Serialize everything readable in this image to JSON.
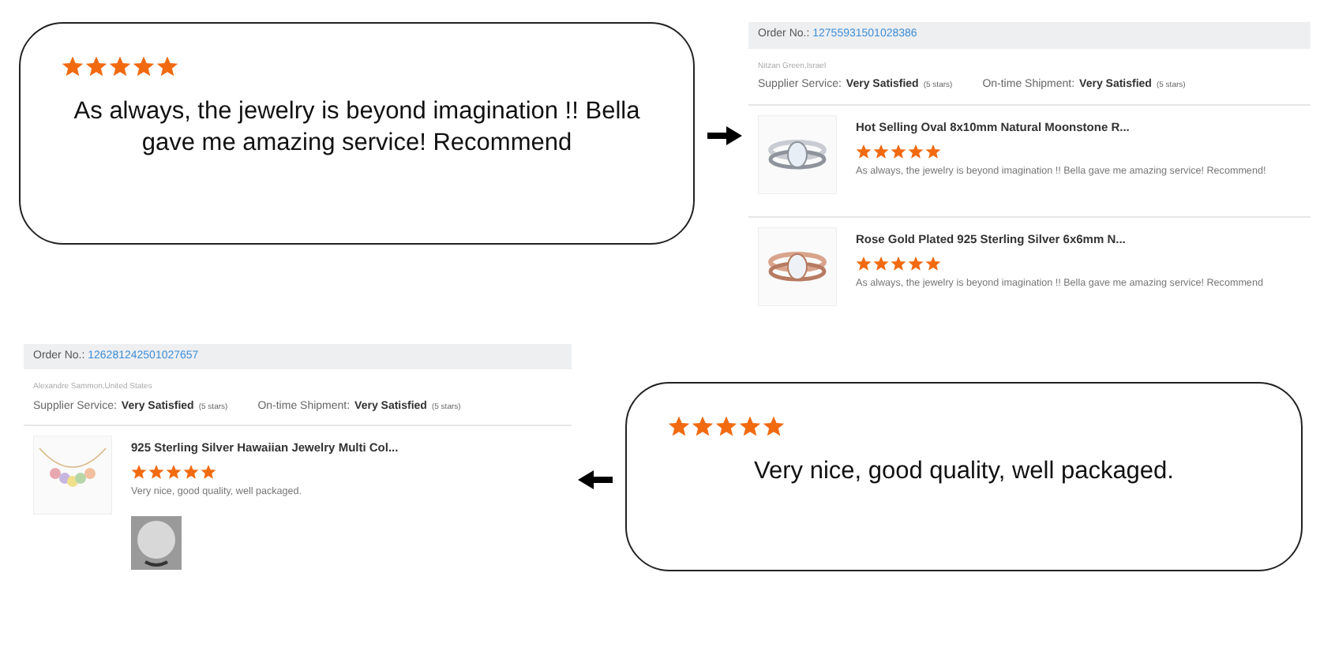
{
  "rows": [
    {
      "parts": [
        {
          "kind": "callout",
          "stars": 5,
          "text": "As always, the jewelry is beyond imagination !! Bella gave me amazing service! Recommend"
        },
        {
          "kind": "arrow_right"
        },
        {
          "kind": "review",
          "order_label": "Order No.:",
          "order_number": "12755931501028386",
          "buyer": "Nitzan Green,Israel",
          "supplier_label": "Supplier Service:",
          "supplier_value": "Very Satisfied",
          "supplier_stars": "(5 stars)",
          "shipment_label": "On-time Shipment:",
          "shipment_value": "Very Satisfied",
          "shipment_stars": "(5 stars)",
          "items": [
            {
              "title": "Hot Selling Oval 8x10mm Natural Moonstone R...",
              "stars": 5,
              "comment": "As always, the jewelry is beyond imagination !!  Bella gave me amazing service!  Recommend!",
              "product": {
                "kind": "picture"
              }
            },
            {
              "title": "Rose Gold Plated 925 Sterling Silver 6x6mm N...",
              "stars": 5,
              "comment": "As always, the jewelry is beyond imagination !!  Bella gave me amazing service!  Recommend",
              "product": {
                "kind": "picture"
              }
            }
          ]
        }
      ]
    },
    {
      "parts": [
        {
          "kind": "review",
          "order_label": "Order No.:",
          "order_number": "126281242501027657",
          "buyer": "Alexandre Sammon,United States",
          "supplier_label": "Supplier Service:",
          "supplier_value": "Very Satisfied",
          "supplier_stars": "(5 stars)",
          "shipment_label": "On-time Shipment:",
          "shipment_value": "Very Satisfied",
          "shipment_stars": "(5 stars)",
          "items": [
            {
              "title": "925 Sterling Silver Hawaiian Jewelry Multi Col...",
              "stars": 5,
              "comment": "Very nice, good quality, well packaged.",
              "product": {
                "kind": "picture"
              },
              "photos": [
                {
                  "kind": "picture"
                }
              ]
            }
          ]
        },
        {
          "kind": "arrow_left"
        },
        {
          "kind": "callout",
          "stars": 5,
          "text": "Very nice, good quality, well packaged."
        }
      ]
    }
  ]
}
